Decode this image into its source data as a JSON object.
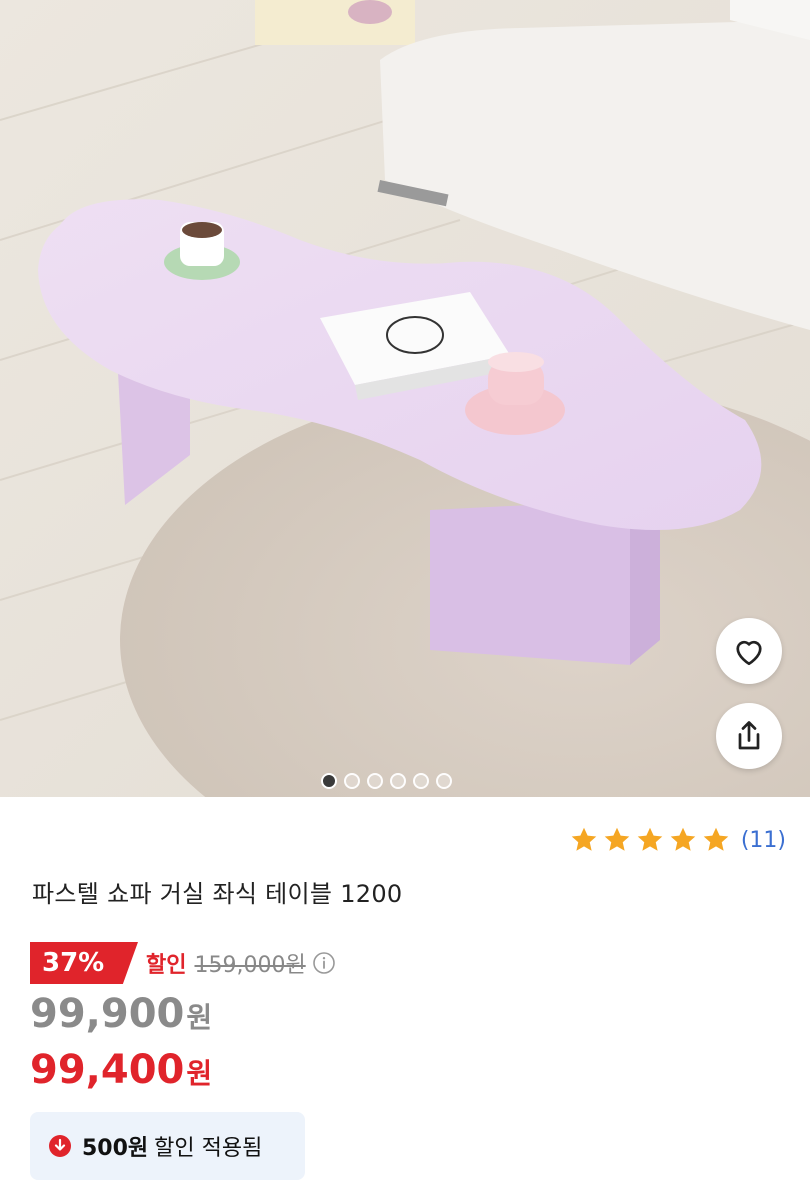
{
  "product": {
    "title": "파스텔 쇼파 거실 좌식 테이블 1200",
    "rating": {
      "stars": 5,
      "review_count": "(11)"
    },
    "discount": {
      "percent": "37%",
      "label": "할인",
      "original_price": "159,000원"
    },
    "list_price": {
      "amount": "99,900",
      "unit": "원"
    },
    "final_price": {
      "amount": "99,400",
      "unit": "원"
    },
    "coupon": {
      "amount": "500원",
      "text": "할인 적용됨"
    }
  },
  "gallery": {
    "image_count": 6,
    "active_index": 0
  },
  "actions": {
    "like_icon": "heart-icon",
    "share_icon": "share-icon"
  },
  "colors": {
    "accent_red": "#e0242b",
    "star_gold": "#f5a623",
    "link_blue": "#3b6fd1",
    "coupon_bg": "#edf3fb"
  }
}
